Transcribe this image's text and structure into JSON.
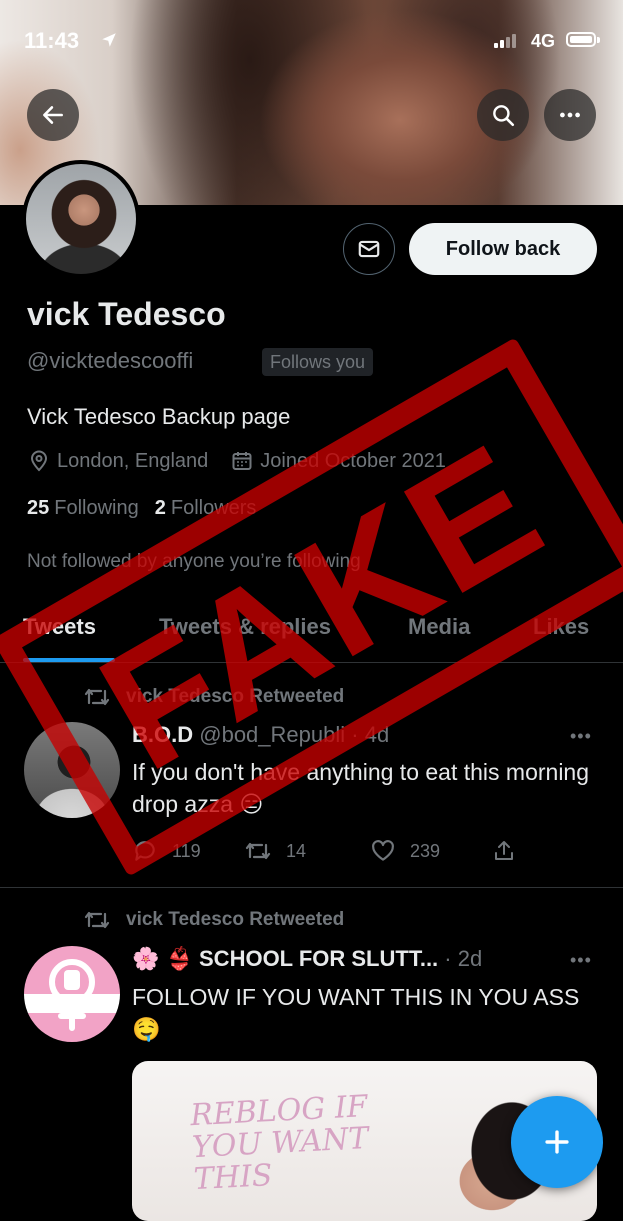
{
  "status_bar": {
    "time": "11:43",
    "network": "4G"
  },
  "profile": {
    "name": "vick Tedesco",
    "handle": "@vicktedescooffi",
    "follows_you": "Follows you",
    "bio": "Vick Tedesco Backup page",
    "location": "London, England",
    "joined": "Joined October 2021",
    "following_count": "25",
    "following_label": "Following",
    "followers_count": "2",
    "followers_label": "Followers",
    "not_followed": "Not followed by anyone you’re following",
    "follow_button": "Follow back"
  },
  "tabs": [
    "Tweets",
    "Tweets & replies",
    "Media",
    "Likes"
  ],
  "tweets": [
    {
      "retweeted_by": "vick Tedesco Retweeted",
      "display_name": "B.O.D",
      "username": "@bod_Republi",
      "time": "· 4d",
      "text": "If you don't have anything to eat this morning drop azza 😑",
      "replies": "119",
      "retweets": "14",
      "likes": "239"
    },
    {
      "retweeted_by": "vick Tedesco Retweeted",
      "display_name": "🌸 👙 SCHOOL FOR SLUTT...",
      "username": "",
      "time": "· 2d",
      "text": "FOLLOW IF YOU WANT THIS IN YOU ASS🤤",
      "media_text": "REBLOG IF YOU WANT THIS"
    }
  ],
  "overlay": {
    "stamp_text": "FAKE"
  },
  "colors": {
    "accent": "#1d9bf0",
    "stamp": "#c80000",
    "background": "#000000"
  }
}
